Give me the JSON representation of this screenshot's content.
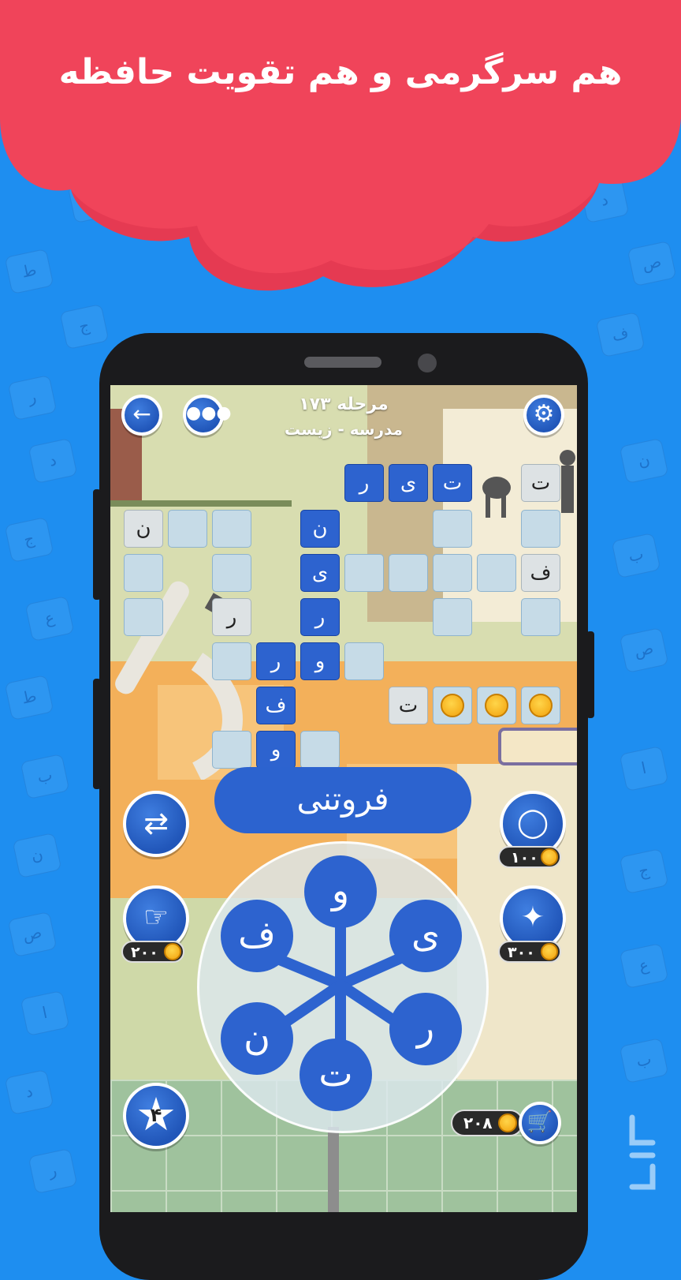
{
  "banner": {
    "headline": "هم سرگرمی و هم تقویت حافظه"
  },
  "level": {
    "title": "مرحله ۱۷۳",
    "subtitle": "مدرسه - زیست"
  },
  "grid": {
    "row1": [
      "ت",
      "ی",
      "ر"
    ],
    "top_right": "ت",
    "col_main": [
      "ن",
      "ی",
      "ر",
      "و"
    ],
    "left_n": "ن",
    "left_r": "ر",
    "right_f": "ف",
    "mid_r": "ر",
    "mid_f": "ف",
    "mid_v": "و",
    "coin_row_t": "ت"
  },
  "current_word": "فروتنی",
  "wheel_letters": [
    "و",
    "ی",
    "ر",
    "ت",
    "ن",
    "ف"
  ],
  "costs": {
    "hint": "۱۰۰",
    "finger": "۲۰۰",
    "magic": "۳۰۰"
  },
  "coins": "۲۰۸",
  "stars": "۴",
  "icons": {
    "back": "back-arrow-icon",
    "menu": "more-dots-icon",
    "settings": "gear-icon",
    "shuffle": "shuffle-icon",
    "hint": "lightbulb-icon",
    "finger": "finger-tap-icon",
    "magic": "magic-wand-icon",
    "cart": "cart-icon",
    "star": "star-icon"
  },
  "colors": {
    "cloud": "#f0445a",
    "background": "#1e8ef0",
    "tile_blue": "#2d63cf"
  }
}
